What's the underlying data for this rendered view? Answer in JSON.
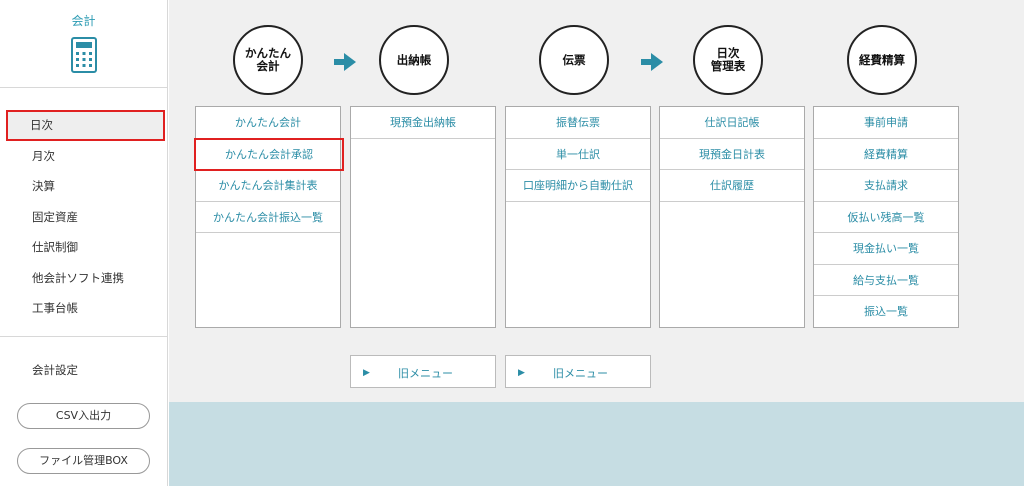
{
  "sidebar": {
    "title": "会計",
    "icon": "calculator-icon",
    "items": [
      {
        "label": "日次",
        "active": true
      },
      {
        "label": "月次"
      },
      {
        "label": "決算"
      },
      {
        "label": "固定資産"
      },
      {
        "label": "仕訳制御"
      },
      {
        "label": "他会計ソフト連携"
      },
      {
        "label": "工事台帳"
      }
    ],
    "settings": "会計設定",
    "csv_button": "CSV入出力",
    "file_button": "ファイル管理BOX"
  },
  "flow": {
    "circles": [
      "かんたん\n会計",
      "出納帳",
      "伝票",
      "日次\n管理表",
      "経費精算"
    ],
    "arrow_color": "#2b8da6"
  },
  "cards": [
    {
      "rows": [
        "かんたん会計",
        "かんたん会計承認",
        "かんたん会計集計表",
        "かんたん会計振込一覧"
      ],
      "highlight_index": 1
    },
    {
      "rows": [
        "現預金出納帳"
      ]
    },
    {
      "rows": [
        "振替伝票",
        "単一仕訳",
        "口座明細から自動仕訳"
      ]
    },
    {
      "rows": [
        "仕訳日記帳",
        "現預金日計表",
        "仕訳履歴"
      ]
    },
    {
      "rows": [
        "事前申請",
        "経費精算",
        "支払請求",
        "仮払い残高一覧",
        "現金払い一覧",
        "給与支払一覧",
        "振込一覧"
      ]
    }
  ],
  "old_menu": [
    "旧メニュー",
    "旧メニュー"
  ],
  "colors": {
    "accent": "#2b8da6",
    "highlight": "#e02020",
    "band": "#c6dde3"
  }
}
